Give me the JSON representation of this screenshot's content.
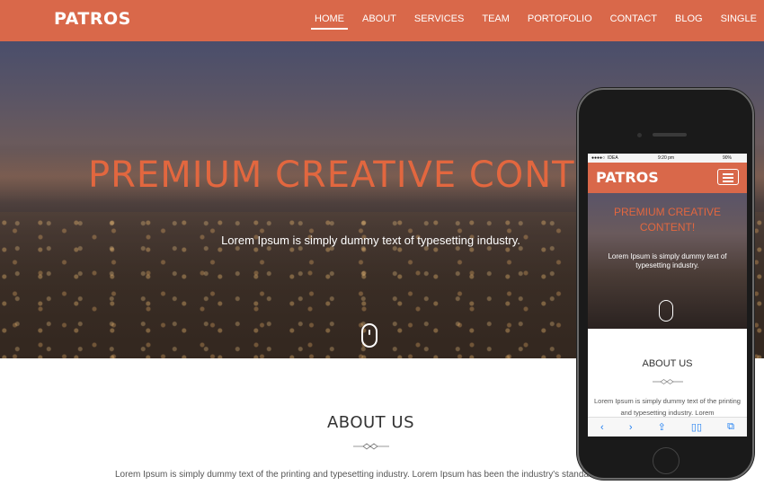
{
  "brand": "PATROS",
  "nav": {
    "items": [
      "HOME",
      "ABOUT",
      "SERVICES",
      "TEAM",
      "PORTOFOLIO",
      "CONTACT",
      "BLOG",
      "SINGLE"
    ],
    "active": "HOME"
  },
  "hero": {
    "title": "PREMIUM CREATIVE CONTENT!",
    "subtitle": "Lorem Ipsum is simply dummy text of typesetting industry."
  },
  "about": {
    "title": "ABOUT US",
    "text": "Lorem Ipsum is simply dummy text of the printing and typesetting industry. Lorem Ipsum has been the industry's standard dummy"
  },
  "mobile": {
    "status": {
      "carrier": "IDEA",
      "time": "9:20 pm",
      "battery": "90%"
    },
    "brand": "PATROS",
    "hero_title": "PREMIUM CREATIVE CONTENT!",
    "hero_subtitle": "Lorem Ipsum is simply dummy text of typesetting industry.",
    "about_title": "ABOUT US",
    "about_text": "Lorem Ipsum is simply dummy text of the printing and typesetting industry. Lorem",
    "toolbar_icons": [
      "back-icon",
      "forward-icon",
      "share-icon",
      "bookmarks-icon",
      "tabs-icon"
    ]
  },
  "colors": {
    "accent": "#d9684a",
    "hero_title": "#e2673f",
    "text_dark": "#333333",
    "ios_blue": "#1e7ef2"
  }
}
